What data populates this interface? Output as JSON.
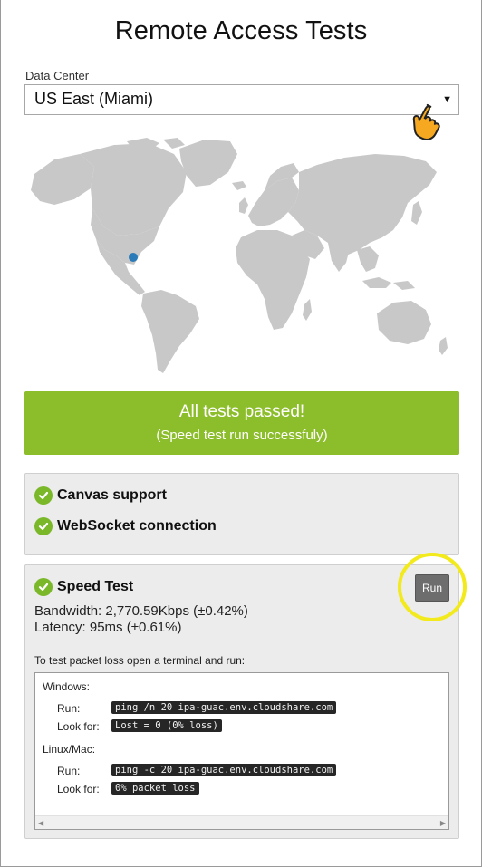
{
  "page": {
    "title": "Remote Access Tests"
  },
  "data_center": {
    "label": "Data Center",
    "selected": "US East (Miami)"
  },
  "status": {
    "headline": "All tests passed!",
    "detail": "(Speed test run successfuly)"
  },
  "checks": [
    {
      "label": "Canvas support"
    },
    {
      "label": "WebSocket connection"
    }
  ],
  "speed_test": {
    "title": "Speed Test",
    "run_label": "Run",
    "bandwidth": "Bandwidth: 2,770.59Kbps (±0.42%)",
    "latency": "Latency: 95ms (±0.61%)"
  },
  "packet_loss": {
    "hint": "To test packet loss open a terminal and run:",
    "windows": {
      "os": "Windows:",
      "run_label": "Run:",
      "run_cmd": "ping /n 20 ipa-guac.env.cloudshare.com",
      "look_label": "Look for:",
      "look_val": "Lost = 0 (0% loss)"
    },
    "linux": {
      "os": "Linux/Mac:",
      "run_label": "Run:",
      "run_cmd": "ping -c 20 ipa-guac.env.cloudshare.com",
      "look_label": "Look for:",
      "look_val": "0% packet loss"
    }
  },
  "colors": {
    "success": "#8cbd2a",
    "check": "#7ab829",
    "highlight": "#f2ea1d",
    "map_land": "#c8c8c8",
    "location_dot": "#2b7bb9"
  },
  "icons": {
    "pointer": "hand-pointer-icon",
    "check": "check-circle-icon",
    "dropdown": "caret-down-icon"
  }
}
